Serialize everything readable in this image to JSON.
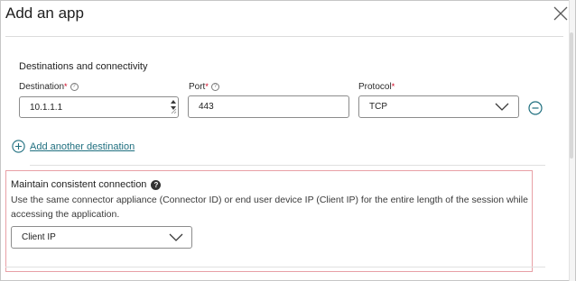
{
  "dialog": {
    "title": "Add an app",
    "icons": {
      "close": "close-icon"
    }
  },
  "destinations": {
    "section_title": "Destinations and connectivity",
    "destination_label": "Destination",
    "port_label": "Port",
    "protocol_label": "Protocol",
    "required_marker": "*",
    "help_glyph": "?",
    "destination_value": "10.1.1.1",
    "port_value": "443",
    "protocol_value": "TCP",
    "add_another": "Add another destination",
    "icons": {
      "remove": "minus-circle-icon",
      "add": "plus-circle-icon",
      "dropdown": "chevron-down-icon",
      "info": "question-circle-icon",
      "stepper": "spin-stepper-icon"
    }
  },
  "consistent_connection": {
    "title": "Maintain consistent connection",
    "help_glyph": "?",
    "description": "Use the same connector appliance (Connector ID) or end user device IP (Client IP) for the entire length of the session while accessing the application.",
    "selected": "Client IP"
  },
  "colors": {
    "accent": "#1f6f7f",
    "required": "#d0001f",
    "highlight_border": "#e8a0a6"
  }
}
